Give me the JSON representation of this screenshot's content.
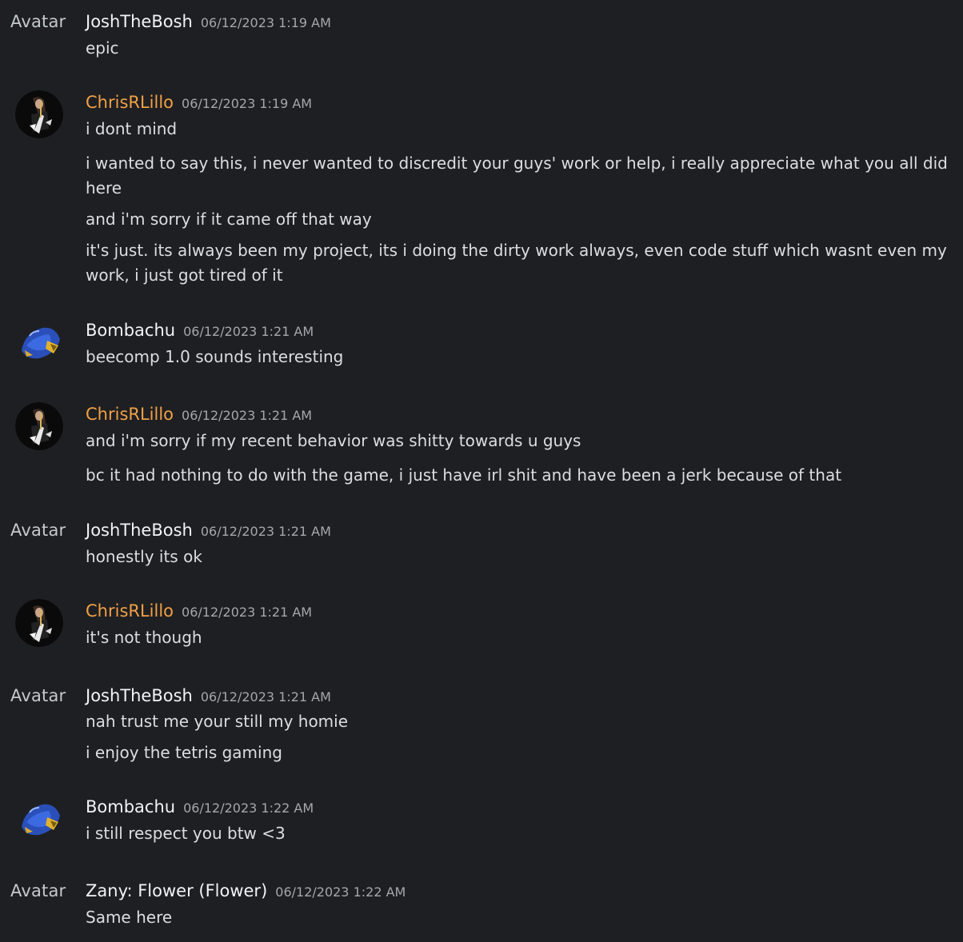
{
  "colors": {
    "background": "#1e1f22",
    "text": "#dbdee1",
    "username_default": "#f2f3f5",
    "username_orange": "#f0a046",
    "timestamp": "#a3a8ae"
  },
  "messages": [
    {
      "avatar_text": "Avatar",
      "username": "JoshTheBosh",
      "timestamp": "06/12/2023 1:19 AM",
      "lines": [
        "epic"
      ]
    },
    {
      "avatar_icon": "guitarist-avatar-icon",
      "username": "ChrisRLillo",
      "timestamp": "06/12/2023 1:19 AM",
      "lines": [
        "i dont mind",
        "i wanted to say this, i never wanted to discredit your guys' work or help, i really appreciate what you all did here",
        "and i'm sorry if it came off that way",
        "it's just. its always been my project, its i doing the dirty work always, even code stuff which wasnt even my work, i just got tired of it"
      ]
    },
    {
      "avatar_icon": "bee-helmet-avatar-icon",
      "username": "Bombachu",
      "timestamp": "06/12/2023 1:21 AM",
      "lines": [
        "beecomp 1.0 sounds interesting"
      ]
    },
    {
      "avatar_icon": "guitarist-avatar-icon",
      "username": "ChrisRLillo",
      "timestamp": "06/12/2023 1:21 AM",
      "lines": [
        "and i'm sorry if my recent behavior was shitty towards u guys",
        "bc it had nothing to do with the game, i just have irl shit and have been a jerk because of that"
      ]
    },
    {
      "avatar_text": "Avatar",
      "username": "JoshTheBosh",
      "timestamp": "06/12/2023 1:21 AM",
      "lines": [
        "honestly its ok"
      ]
    },
    {
      "avatar_icon": "guitarist-avatar-icon",
      "username": "ChrisRLillo",
      "timestamp": "06/12/2023 1:21 AM",
      "lines": [
        "it's not though"
      ]
    },
    {
      "avatar_text": "Avatar",
      "username": "JoshTheBosh",
      "timestamp": "06/12/2023 1:21 AM",
      "lines": [
        "nah trust me your still my homie",
        "i enjoy the tetris gaming"
      ]
    },
    {
      "avatar_icon": "bee-helmet-avatar-icon",
      "username": "Bombachu",
      "timestamp": "06/12/2023 1:22 AM",
      "lines": [
        "i still respect you btw <3"
      ]
    },
    {
      "avatar_text": "Avatar",
      "username": "Zany: Flower (Flower)",
      "timestamp": "06/12/2023 1:22 AM",
      "lines": [
        "Same here"
      ]
    }
  ]
}
